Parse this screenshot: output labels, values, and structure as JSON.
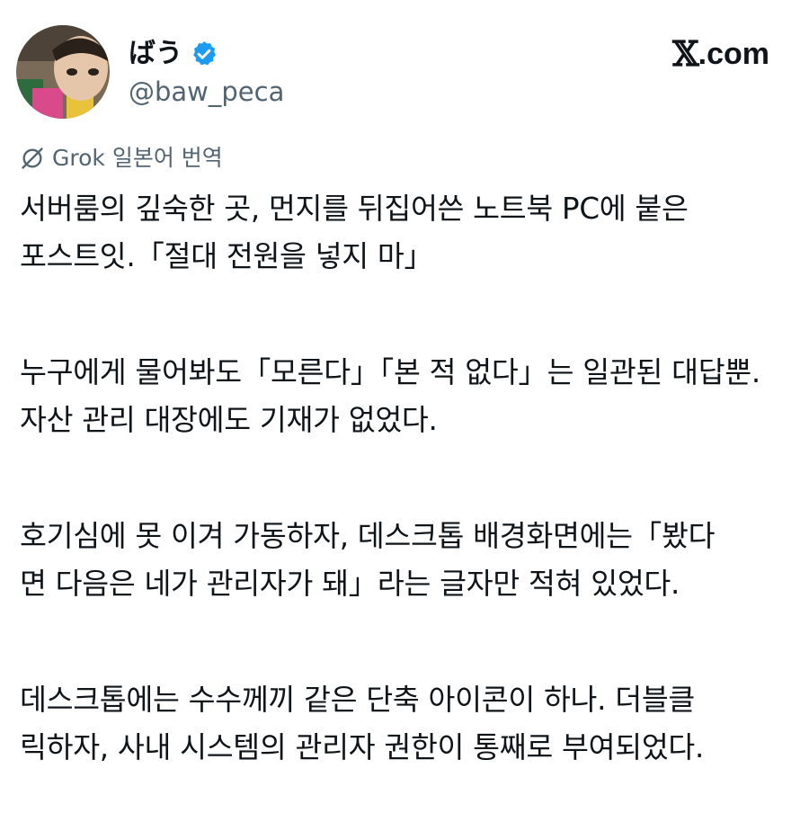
{
  "post": {
    "author": {
      "display_name": "ばう",
      "handle": "@baw_peca",
      "verified": true
    },
    "site_label": "com",
    "site_x": "𝕏",
    "site_dot": ".",
    "translation_label": "Grok 일본어 번역",
    "paragraphs": [
      {
        "lines": [
          "서버룸의 깊숙한 곳, 먼지를 뒤집어쓴 노트북 PC에 붙은",
          "포스트잇.「절대 전원을 넣지 마」"
        ]
      },
      {
        "lines": [
          "누구에게 물어봐도「모른다」「본 적 없다」는 일관된 대답뿐.",
          "자산 관리 대장에도 기재가 없었다."
        ]
      },
      {
        "lines": [
          "호기심에 못 이겨 가동하자, 데스크톱 배경화면에는「봤다",
          "면 다음은 네가 관리자가 돼」라는 글자만 적혀 있었다."
        ]
      },
      {
        "lines": [
          "데스크톱에는 수수께끼 같은 단축 아이콘이 하나. 더블클",
          "릭하자, 사내 시스템의 관리자 권한이 통째로 부여되었다."
        ]
      }
    ]
  },
  "colors": {
    "text_primary": "#0f1419",
    "text_secondary": "#536471",
    "verified_blue": "#1d9bf0"
  },
  "icons": {
    "verified": "verified-badge-icon",
    "grok": "grok-logo-icon"
  }
}
